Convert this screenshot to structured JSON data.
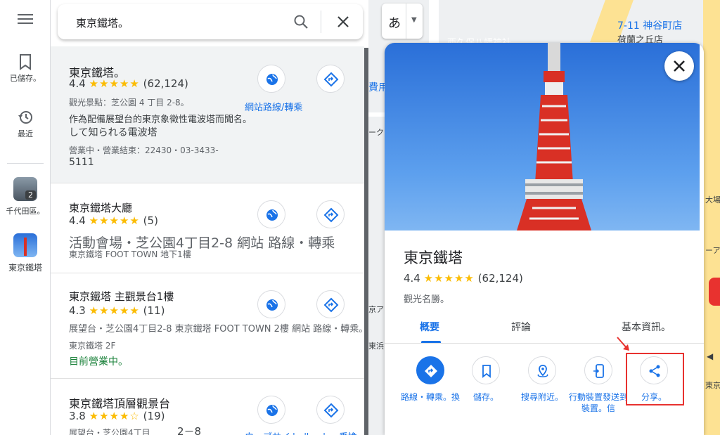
{
  "rail": {
    "saved_label": "已儲存。",
    "recent_label": "最近",
    "history_thumb_label": "千代田區。",
    "history_thumb_badge": "2",
    "current_thumb_label": "東京鐵塔"
  },
  "search": {
    "query": "東京鐵塔。"
  },
  "results": [
    {
      "title": "東京鐵塔。",
      "rating": "4.4",
      "stars": "★★★★★",
      "count": "(62,124)",
      "line1": "觀光景點：芝公園 4 丁目 2-8。",
      "line2": "作為配備展望台的東京象徵性電波塔而聞名。",
      "line3": "して知られる電波塔",
      "line4": "營業中・營業結束：22430・03-3433-",
      "line5": "5111",
      "site_label": "網站路線/轉乘"
    },
    {
      "title": "東京鐵塔大廳",
      "rating": "4.4",
      "stars": "★★★★★",
      "count": "(5)",
      "line1": "活動會場・芝公園4丁目2-8 網站 路線・轉乘",
      "line2": "東京鐵塔 FOOT TOWN 地下1樓"
    },
    {
      "title": "東京鐵塔 主觀景台1樓",
      "rating": "4.3",
      "stars": "★★★★★",
      "count": "(11)",
      "line1": "展望台・芝公園4丁目2-8 東京鐵塔 FOOT TOWN 2樓 網站 路線・轉乘。",
      "line2": "東京鐵塔 2F",
      "line3": "目前營業中。"
    },
    {
      "title": "東京鐵塔頂層觀景台",
      "rating": "3.8",
      "stars": "★★★★☆",
      "count": "(19)",
      "line1": "展望台・芝公園4丁目",
      "line1b": "2－8",
      "line2": "ウェブサイト ルート・乗換"
    }
  ],
  "lang_button": {
    "char": "あ"
  },
  "map_labels": {
    "store": "7-11 神谷町店",
    "area": "荷蘭之丘店",
    "shrine": "西久保八幡神社",
    "fee": "費用",
    "k1": "ーク",
    "k2": "京ア",
    "k3": "東浜",
    "k4": "大場",
    "k5": "ーア",
    "k6": "東京"
  },
  "place": {
    "name": "東京鐵塔",
    "rating": "4.4",
    "stars": "★★★★★",
    "count": "(62,124)",
    "category": "觀光名勝。",
    "tabs": [
      "概要",
      "評論",
      "基本資訊。"
    ],
    "actions": [
      {
        "label": "路線・轉乘。換",
        "icon": "directions-icon"
      },
      {
        "label": "儲存。",
        "icon": "bookmark-icon"
      },
      {
        "label": "搜尋附近。",
        "icon": "nearby-icon"
      },
      {
        "label": "行動裝置發送到裝置。信",
        "icon": "send-to-phone-icon"
      },
      {
        "label": "分享。",
        "icon": "share-icon"
      }
    ]
  },
  "colors": {
    "accent": "#1a73e8",
    "star": "#fbbc04",
    "open": "#188038",
    "highlight": "#e8322f"
  }
}
